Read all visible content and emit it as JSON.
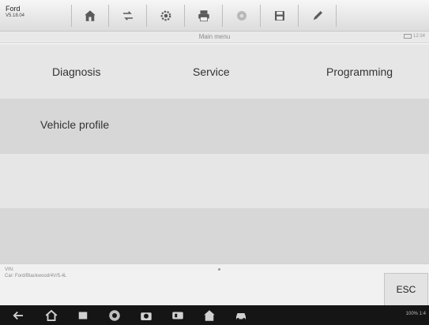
{
  "app": {
    "name": "Ford",
    "version": "V5.18.04"
  },
  "toolbar": {
    "items": [
      {
        "name": "home-icon"
      },
      {
        "name": "vehicle-swap-icon"
      },
      {
        "name": "settings-gear-icon"
      },
      {
        "name": "print-icon"
      },
      {
        "name": "help-icon"
      },
      {
        "name": "save-icon"
      },
      {
        "name": "edit-pen-icon"
      }
    ]
  },
  "title": {
    "text": "Main menu",
    "meta": "12:34"
  },
  "menu": {
    "diagnosis": "Diagnosis",
    "service": "Service",
    "programming": "Programming",
    "vehicle_profile": "Vehicle profile"
  },
  "info": {
    "vin": "VIN:",
    "car": "Car: Ford/Blackwood/4V/5.4L"
  },
  "esc": "ESC",
  "statusbar": {
    "text": "100% 1:4"
  },
  "colors": {
    "toolbar": "#e6e6e6",
    "row_light": "#e6e6e6",
    "row_dark": "#d7d7d7",
    "navbar": "#151515"
  }
}
